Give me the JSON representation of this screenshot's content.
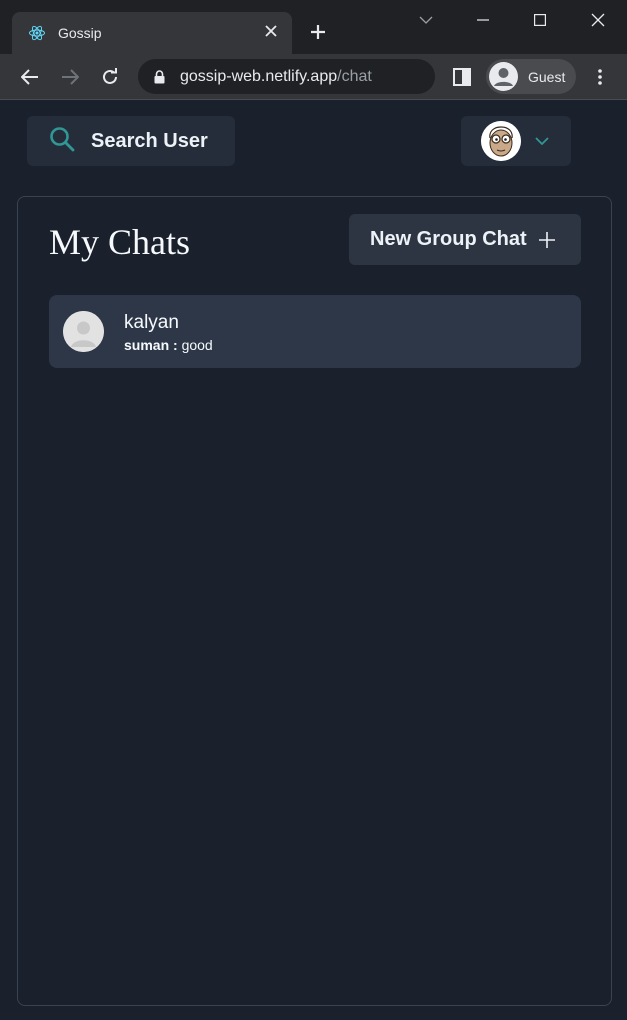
{
  "browser": {
    "tab_title": "Gossip",
    "url_host": "gossip-web.netlify.app",
    "url_path": "/chat",
    "profile_label": "Guest"
  },
  "header": {
    "search_label": "Search User"
  },
  "chats": {
    "title": "My Chats",
    "new_group_label": "New Group Chat",
    "items": [
      {
        "name": "kalyan",
        "sender": "suman :",
        "message": "good"
      }
    ]
  },
  "colors": {
    "accent": "#319795",
    "background": "#1a202c",
    "chat_item": "#2d3748"
  }
}
